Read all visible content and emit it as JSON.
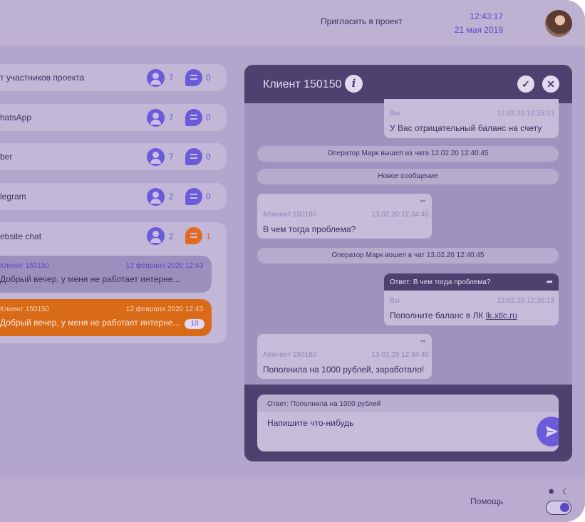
{
  "header": {
    "invite_label": "Пригласить в проект",
    "time": "12:43:17",
    "date": "21 мая 2019"
  },
  "channels": [
    {
      "name": "т участников проекта",
      "users": "7",
      "messages": "0"
    },
    {
      "name": "hatsApp",
      "users": "7",
      "messages": "0"
    },
    {
      "name": "ber",
      "users": "7",
      "messages": "0"
    },
    {
      "name": "legram",
      "users": "2",
      "messages": "0"
    },
    {
      "name": "ebsite chat",
      "users": "2",
      "messages": "1"
    }
  ],
  "conversations": [
    {
      "client": "Клиент 150150",
      "date": "12 февраля 2020   12:43",
      "preview": "Добрый вечер, у меня не работает интерне..."
    },
    {
      "client": "Клиент 150150",
      "date": "12 февраля 2020   12:43",
      "preview": "Добрый вечер, у меня не работает интерне...",
      "badge": "10"
    }
  ],
  "chat": {
    "title": "Клиент 150150",
    "messages": {
      "m1": {
        "author": "Вы",
        "time": "12.02.20 12:35:13",
        "text": "У Вас отрицательный баланс на счету"
      },
      "sys1": "Оператор Марк вышел из чата 12.02.20 12:40:45",
      "sys2": "Новое сообщение",
      "m2": {
        "author": "Абонент 150180",
        "time": "13.02.20 12:34:45",
        "text": "В чем тогда проблема?"
      },
      "sys3": "Оператор Марк вошел в чат 13.02.20 12:40:45",
      "m3": {
        "reply": "Ответ: В чем тогда проблема?",
        "author": "Вы",
        "time": "12.02.20 12:35:13",
        "text": "Пополните баланс в ЛК ",
        "link": "lk.xtlc.ru"
      },
      "m4": {
        "author": "Абонент 150180",
        "time": "13.02.20 12:34:45",
        "text": "Пополнила на 1000 рублей, заработало!"
      }
    },
    "composer": {
      "reply_quote": "Ответ: Пополнила на 1000 рублей",
      "placeholder": "Напишите что-нибудь"
    }
  },
  "footer": {
    "help_label": "Помощь"
  },
  "colors": {
    "accent": "#6c5bd9",
    "orange": "#e06a1f",
    "dark_panel": "#4d416f"
  }
}
